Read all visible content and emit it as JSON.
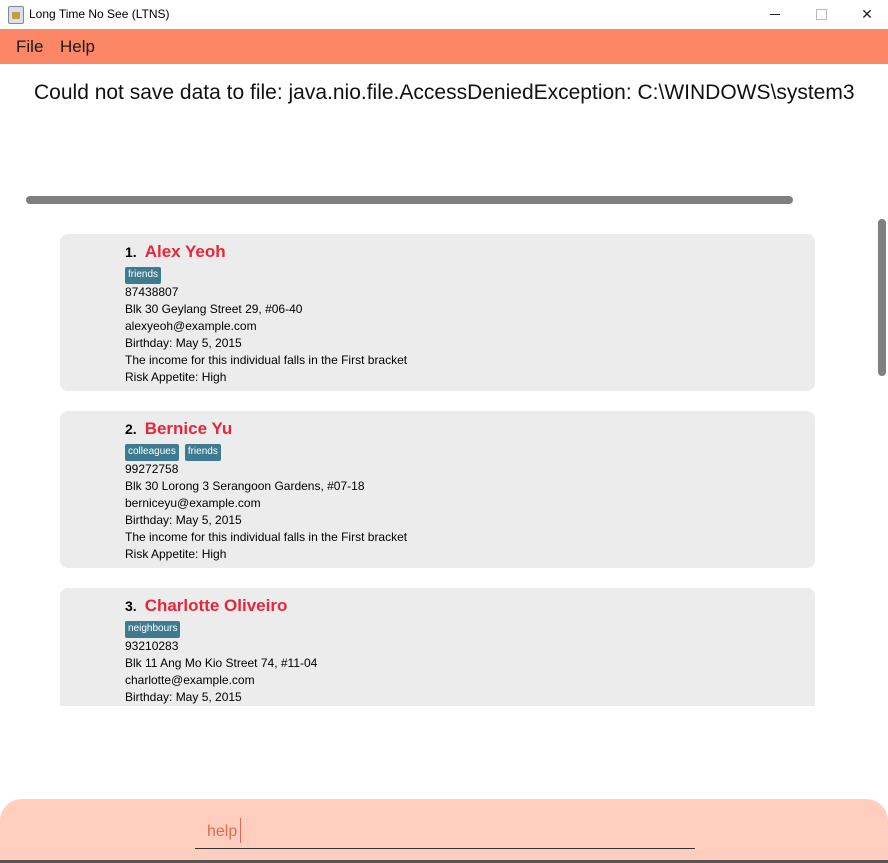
{
  "window": {
    "title": "Long Time No See (LTNS)",
    "controls": {
      "minimize": "minimize",
      "maximize": "maximize",
      "close": "✕"
    }
  },
  "menu": {
    "items": [
      "File",
      "Help"
    ]
  },
  "result": {
    "message": "Could not save data to file: java.nio.file.AccessDeniedException: C:\\WINDOWS\\system3"
  },
  "persons": [
    {
      "index": "1.",
      "name": "Alex Yeoh",
      "tags": [
        "friends"
      ],
      "phone": "87438807",
      "address": "Blk 30 Geylang Street 29, #06-40",
      "email": "alexyeoh@example.com",
      "birthday": "Birthday: May 5, 2015",
      "income": "The income for this individual falls in the First bracket",
      "risk": "Risk Appetite: High"
    },
    {
      "index": "2.",
      "name": "Bernice Yu",
      "tags": [
        "colleagues",
        "friends"
      ],
      "phone": "99272758",
      "address": "Blk 30 Lorong 3 Serangoon Gardens, #07-18",
      "email": "berniceyu@example.com",
      "birthday": "Birthday: May 5, 2015",
      "income": "The income for this individual falls in the First bracket",
      "risk": "Risk Appetite: High"
    },
    {
      "index": "3.",
      "name": "Charlotte Oliveiro",
      "tags": [
        "neighbours"
      ],
      "phone": "93210283",
      "address": "Blk 11 Ang Mo Kio Street 74, #11-04",
      "email": "charlotte@example.com",
      "birthday": "Birthday: May 5, 2015"
    }
  ],
  "command": {
    "value": "help"
  },
  "colors": {
    "menu_bg": "#fb8766",
    "name": "#e8263a",
    "tag_bg": "#3e7b91",
    "card_bg": "#ececec",
    "command_bg": "#ffcebf"
  }
}
